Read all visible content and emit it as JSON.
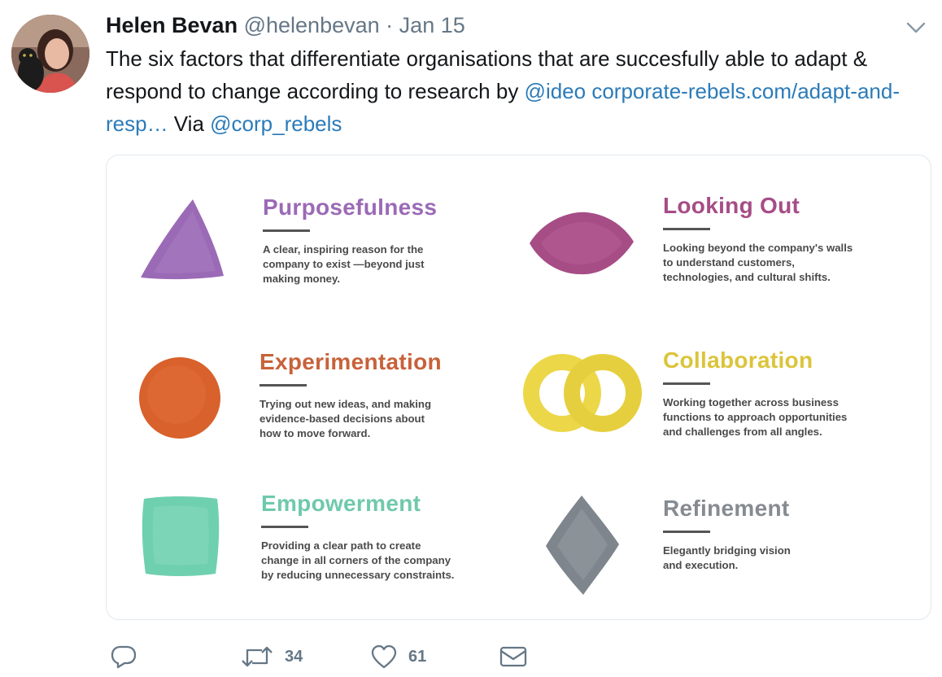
{
  "tweet": {
    "author_name": "Helen Bevan",
    "handle": "@helenbevan",
    "separator": "·",
    "date": "Jan 15",
    "text_part1": "The six factors that differentiate organisations that are succesfully able to adapt & respond to change according to research by ",
    "mention_ideo": "@ideo",
    "link_text": "corporate-rebels.com/adapt-and-resp…",
    "via_text": " Via ",
    "mention_corp": "@corp_rebels"
  },
  "infographic": {
    "items": [
      {
        "title": "Purposefulness",
        "color": "#9b6ab6",
        "lines": [
          "A clear, inspiring reason for the",
          "company to exist —beyond just",
          "making money."
        ]
      },
      {
        "title": "Looking Out",
        "color": "#a64d86",
        "lines": [
          "Looking beyond the company's walls",
          "to understand customers,",
          "technologies, and cultural shifts."
        ]
      },
      {
        "title": "Experimentation",
        "color": "#c8623a",
        "lines": [
          "Trying out new ideas, and making",
          "evidence-based decisions about",
          "how to move forward."
        ]
      },
      {
        "title": "Collaboration",
        "color": "#dcc43a",
        "lines": [
          "Working together across business",
          "functions to approach opportunities",
          "and challenges from all angles."
        ]
      },
      {
        "title": "Empowerment",
        "color": "#6fc9ac",
        "lines": [
          "Providing a clear path to create",
          "change in all corners of the company",
          "by reducing unnecessary constraints."
        ]
      },
      {
        "title": "Refinement",
        "color": "#858b91",
        "lines": [
          "Elegantly bridging vision",
          "and execution."
        ]
      }
    ]
  },
  "actions": {
    "reply_icon": "reply-icon",
    "retweet_icon": "retweet-icon",
    "retweet_count": "34",
    "like_icon": "heart-icon",
    "like_count": "61",
    "dm_icon": "envelope-icon"
  }
}
